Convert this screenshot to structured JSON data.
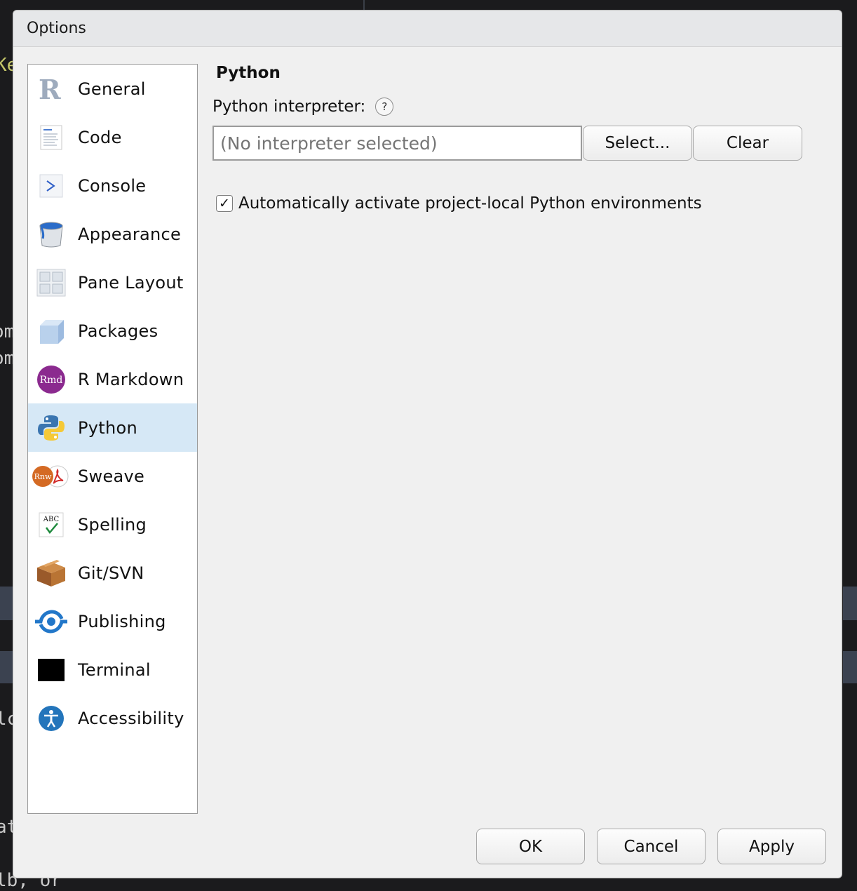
{
  "background": {
    "fragments": [
      "Ke",
      "om",
      "om",
      "lc",
      "at",
      "lb, or"
    ]
  },
  "dialog": {
    "title": "Options",
    "nav_items": [
      {
        "label": "General",
        "icon": "r-logo-icon"
      },
      {
        "label": "Code",
        "icon": "code-document-icon"
      },
      {
        "label": "Console",
        "icon": "console-prompt-icon"
      },
      {
        "label": "Appearance",
        "icon": "paint-bucket-icon"
      },
      {
        "label": "Pane Layout",
        "icon": "pane-grid-icon"
      },
      {
        "label": "Packages",
        "icon": "package-cube-icon"
      },
      {
        "label": "R Markdown",
        "icon": "rmd-icon",
        "icon_text": "Rmd"
      },
      {
        "label": "Python",
        "icon": "python-icon"
      },
      {
        "label": "Sweave",
        "icon": "sweave-icon",
        "icon_text": "Rnw"
      },
      {
        "label": "Spelling",
        "icon": "spelling-check-icon",
        "icon_text": "ABC"
      },
      {
        "label": "Git/SVN",
        "icon": "git-box-icon"
      },
      {
        "label": "Publishing",
        "icon": "publishing-icon"
      },
      {
        "label": "Terminal",
        "icon": "terminal-icon"
      },
      {
        "label": "Accessibility",
        "icon": "accessibility-icon"
      }
    ],
    "active_item": "Python",
    "python": {
      "section_title": "Python",
      "interpreter_label": "Python interpreter:",
      "help_glyph": "?",
      "interpreter_placeholder": "(No interpreter selected)",
      "select_label": "Select...",
      "clear_label": "Clear",
      "auto_activate_label": "Automatically activate project-local Python environments",
      "auto_activate_checked": true,
      "check_glyph": "✓"
    },
    "footer": {
      "ok_label": "OK",
      "cancel_label": "Cancel",
      "apply_label": "Apply"
    }
  },
  "colors": {
    "active_item_bg": "#d6e8f6",
    "dialog_bg": "#f0f0f0"
  }
}
